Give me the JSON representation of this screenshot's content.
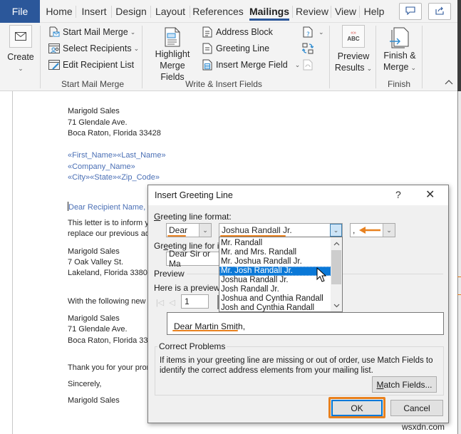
{
  "ribbon_tabs": {
    "file": "File",
    "tabs": [
      "Home",
      "Insert",
      "Design",
      "Layout",
      "References",
      "Mailings",
      "Review",
      "View",
      "Help"
    ],
    "active": "Mailings",
    "comments_icon": "comment-icon",
    "share_icon": "share-icon"
  },
  "ribbon": {
    "create": {
      "label": "Create",
      "icon": "envelope-icon"
    },
    "start_mail_merge_group": {
      "label": "Start Mail Merge",
      "items": [
        {
          "label": "Start Mail Merge",
          "icon": "start-mail-merge-icon",
          "dropdown": true
        },
        {
          "label": "Select Recipients",
          "icon": "select-recipients-icon",
          "dropdown": true
        },
        {
          "label": "Edit Recipient List",
          "icon": "edit-recipient-list-icon",
          "dropdown": false
        }
      ]
    },
    "write_insert_group": {
      "label": "Write & Insert Fields",
      "highlight": {
        "line1": "Highlight",
        "line2": "Merge Fields"
      },
      "items": [
        {
          "label": "Address Block",
          "icon": "address-block-icon"
        },
        {
          "label": "Greeting Line",
          "icon": "greeting-line-icon"
        },
        {
          "label": "Insert Merge Field",
          "icon": "insert-merge-field-icon",
          "dropdown": true
        }
      ],
      "small_icons": [
        "rules-icon",
        "match-fields-icon",
        "update-labels-icon"
      ]
    },
    "preview_group": {
      "line1": "Preview",
      "line2": "Results",
      "icon_text": "ABC"
    },
    "finish_group": {
      "label": "Finish",
      "line1": "Finish &",
      "line2": "Merge"
    },
    "collapse_icon": "chevron-up-icon"
  },
  "document": {
    "sender": [
      "Marigold Sales",
      "71 Glendale Ave.",
      "Boca Raton, Florida 33428"
    ],
    "fields": [
      "«First_Name»«Last_Name»",
      "«Company_Name»",
      "«City»«State»«Zip_Code»"
    ],
    "greeting": "Dear Recipient Name,",
    "body1": [
      "This letter is to inform y",
      "replace our previous ad"
    ],
    "old_address": [
      "Marigold Sales",
      "7 Oak Valley St.",
      "Lakeland, Florida 33801"
    ],
    "body2": "With the following new",
    "new_address": [
      "Marigold Sales",
      "71 Glendale Ave.",
      "Boca Raton, Florida 334"
    ],
    "thanks": "Thank you for your pror",
    "closing": "Sincerely,",
    "signature": "Marigold Sales"
  },
  "dialog": {
    "title": "Insert Greeting Line",
    "help": "?",
    "close": "✕",
    "format_label_u": "G",
    "format_label_rest": "reeting line format:",
    "salutation": "Dear",
    "name_format": "Joshua Randall Jr.",
    "punctuation": ",",
    "invalid_label_pre": "Gr",
    "invalid_label_u": "e",
    "invalid_label_rest": "eting line for i",
    "invalid_value": "Dear Sir or Ma",
    "name_options": [
      "Mr. Randall",
      "Mr. and Mrs. Randall",
      "Mr. Joshua Randall Jr.",
      "Mr. Josh Randall Jr.",
      "Joshua Randall Jr.",
      "Josh Randall Jr.",
      "Joshua and Cynthia Randall",
      "Josh and Cynthia Randall"
    ],
    "highlighted_option": "Mr. Josh Randall Jr.",
    "preview_label": "Preview",
    "preview_hint": "Here is a preview f",
    "record_number": "1",
    "preview_text": "Dear Martin Smith,",
    "correct_problems_title": "Correct Problems",
    "correct_problems_text": "If items in your greeting line are missing or out of order, use Match Fields to identify the correct address elements from your mailing list.",
    "match_fields_u": "M",
    "match_fields_rest": "atch Fields...",
    "ok": "OK",
    "cancel": "Cancel"
  },
  "annotation_color": "#e8811f",
  "accent_color": "#2b579a",
  "watermark": "wsxdn.com"
}
